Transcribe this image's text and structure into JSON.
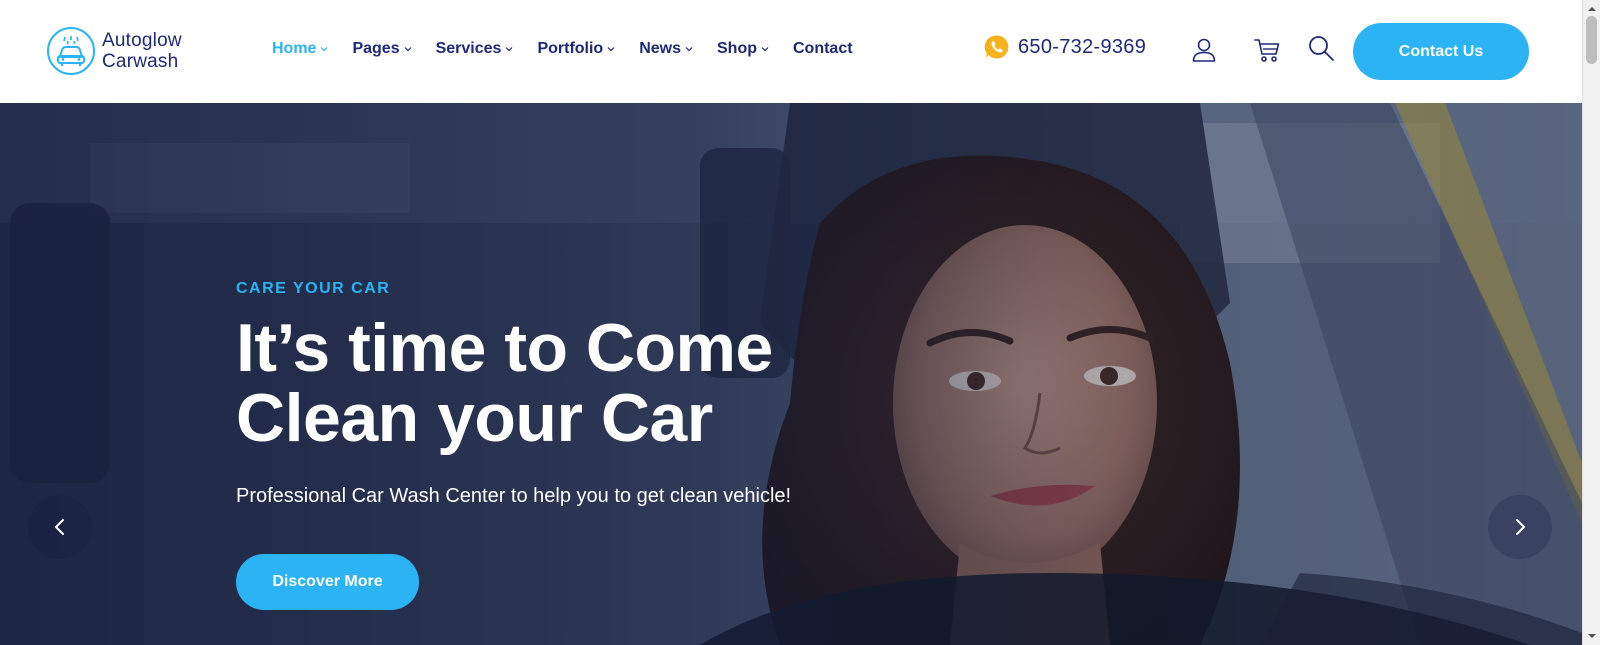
{
  "brand": {
    "line1": "Autoglow",
    "line2": "Carwash",
    "logo_icon": "car-wash-icon",
    "accent_color": "#2bb3f3",
    "navy_color": "#1e2a78"
  },
  "nav": {
    "items": [
      {
        "label": "Home",
        "active": true,
        "dropdown": true
      },
      {
        "label": "Pages",
        "active": false,
        "dropdown": true
      },
      {
        "label": "Services",
        "active": false,
        "dropdown": true
      },
      {
        "label": "Portfolio",
        "active": false,
        "dropdown": true
      },
      {
        "label": "News",
        "active": false,
        "dropdown": true
      },
      {
        "label": "Shop",
        "active": false,
        "dropdown": true
      },
      {
        "label": "Contact",
        "active": false,
        "dropdown": false
      }
    ]
  },
  "header": {
    "phone": "650-732-9369",
    "phone_icon": "whatsapp-icon",
    "icons": [
      "user-icon",
      "cart-icon",
      "search-icon"
    ],
    "contact_label": "Contact Us"
  },
  "hero": {
    "eyebrow": "CARE YOUR CAR",
    "headline_line1": "It’s time to Come",
    "headline_line2": "Clean your Car",
    "subtext": "Professional Car Wash Center to help you to get clean vehicle!",
    "button_label": "Discover More",
    "prev_icon": "chevron-left-icon",
    "next_icon": "chevron-right-icon"
  }
}
